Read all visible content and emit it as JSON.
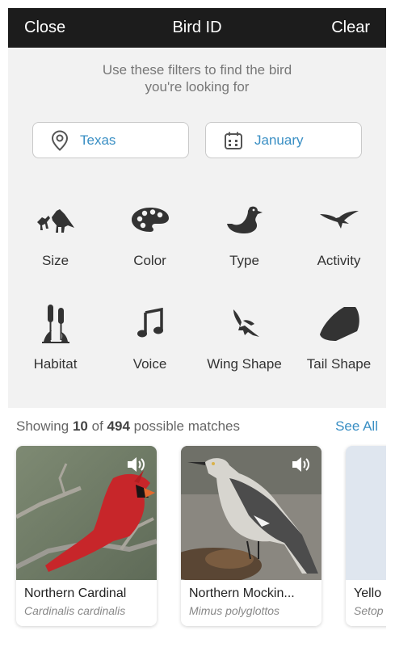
{
  "header": {
    "close_label": "Close",
    "title": "Bird ID",
    "clear_label": "Clear"
  },
  "filters": {
    "hint": "Use these filters to find the bird you're looking for",
    "location": {
      "value": "Texas",
      "icon": "location-pin-icon"
    },
    "date": {
      "value": "January",
      "icon": "calendar-icon"
    },
    "categories": [
      {
        "label": "Size",
        "icon": "size-birds-icon"
      },
      {
        "label": "Color",
        "icon": "palette-icon"
      },
      {
        "label": "Type",
        "icon": "duck-icon"
      },
      {
        "label": "Activity",
        "icon": "flying-bird-icon"
      },
      {
        "label": "Habitat",
        "icon": "cattail-icon"
      },
      {
        "label": "Voice",
        "icon": "music-note-icon"
      },
      {
        "label": "Wing Shape",
        "icon": "wing-shape-icon"
      },
      {
        "label": "Tail Shape",
        "icon": "tail-shape-icon"
      }
    ]
  },
  "results": {
    "prefix": "Showing",
    "shown": "10",
    "of_label": "of",
    "total": "494",
    "suffix": "possible matches",
    "see_all_label": "See All",
    "cards": [
      {
        "common_name": "Northern Cardinal",
        "scientific_name": "Cardinalis cardinalis",
        "icon": "speaker-icon"
      },
      {
        "common_name": "Northern Mockin...",
        "scientific_name": "Mimus polyglottos",
        "icon": "speaker-icon"
      },
      {
        "common_name": "Yello",
        "scientific_name": "Setop",
        "icon": ""
      }
    ]
  },
  "colors": {
    "accent": "#3a8fc4",
    "header_bg": "#1c1c1c",
    "panel_bg": "#f2f2f2",
    "icon": "#333333"
  }
}
